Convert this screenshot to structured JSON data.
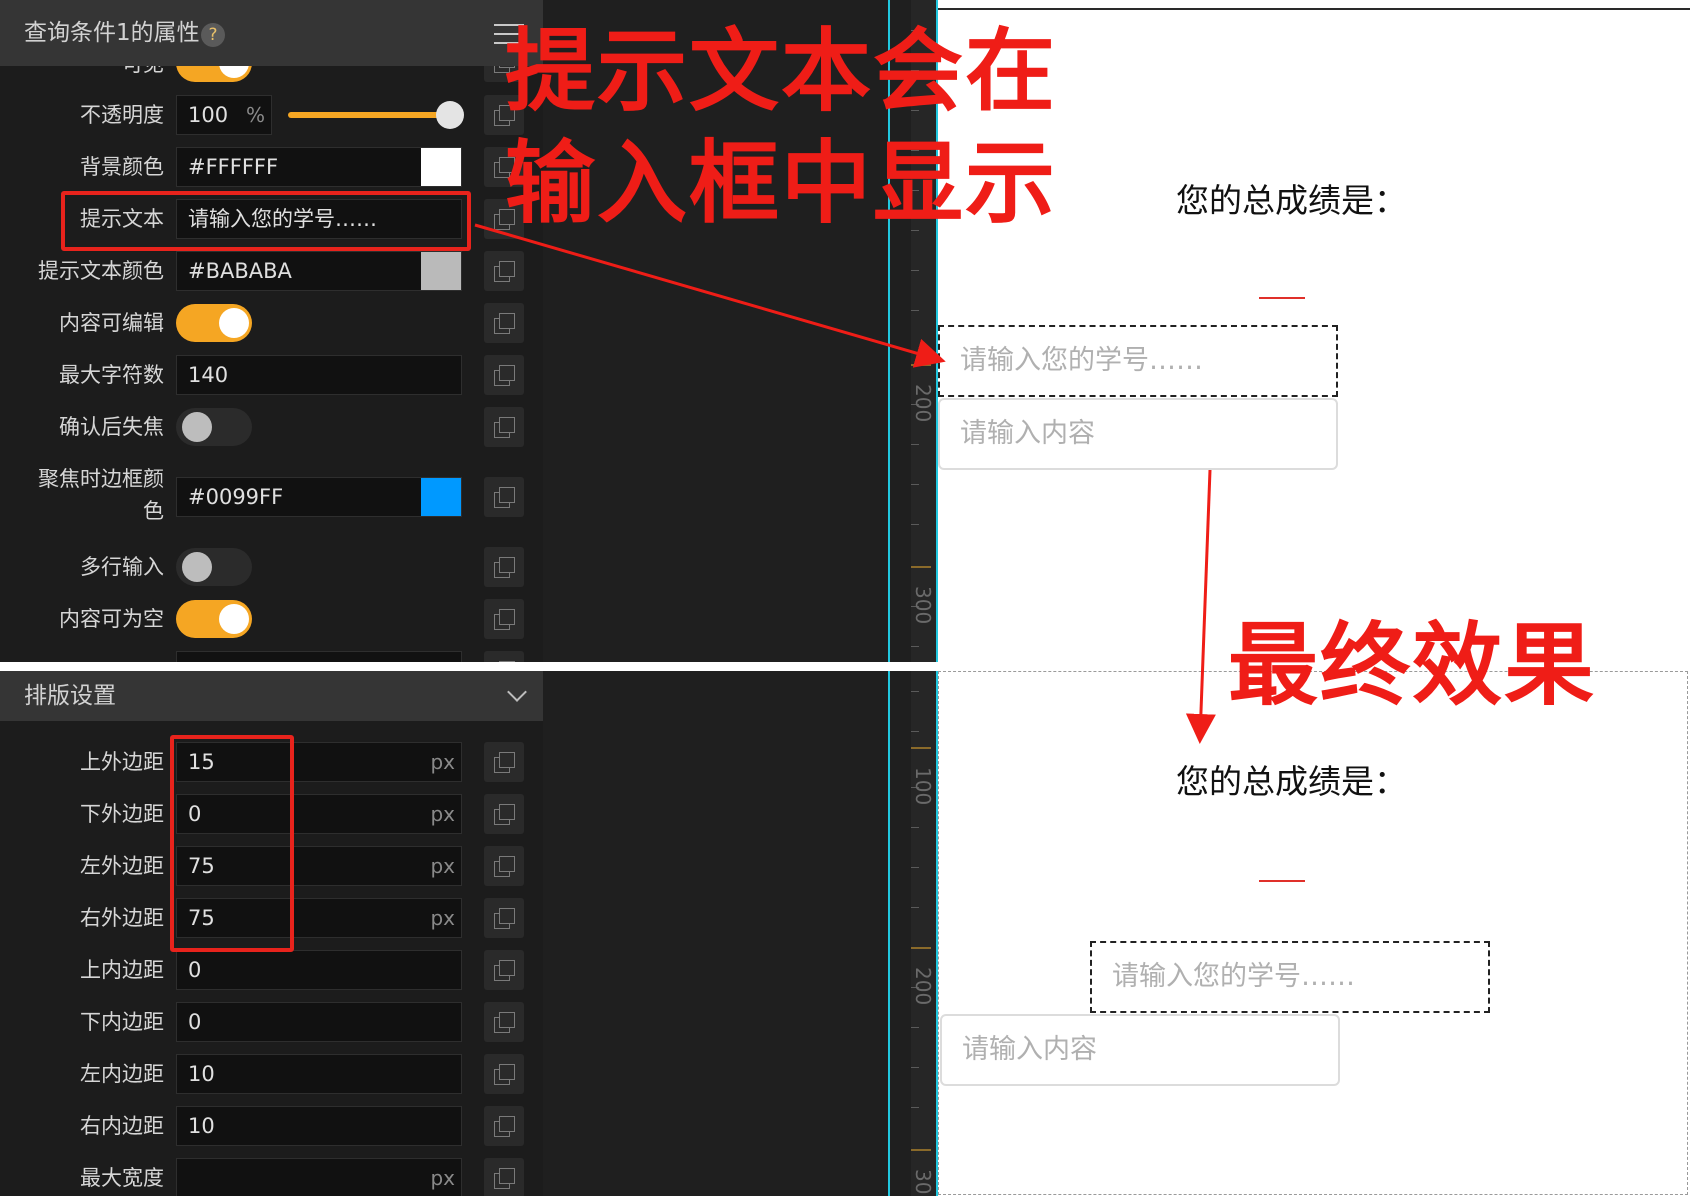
{
  "top_panel": {
    "title": "查询条件1的属性",
    "help": "?",
    "rows": {
      "visible": {
        "label": "可见",
        "on": true
      },
      "opacity": {
        "label": "不透明度",
        "value": "100",
        "unit": "%",
        "level": 1.0
      },
      "bg_color": {
        "label": "背景颜色",
        "value": "#FFFFFF",
        "swatch": "#FFFFFF"
      },
      "placeholder": {
        "label": "提示文本",
        "value": "请输入您的学号……"
      },
      "placeholder_color": {
        "label": "提示文本颜色",
        "value": "#BABABA",
        "swatch": "#BABABA"
      },
      "editable": {
        "label": "内容可编辑",
        "on": true
      },
      "max_chars": {
        "label": "最大字符数",
        "value": "140"
      },
      "blur_on_confirm": {
        "label": "确认后失焦",
        "on": false
      },
      "focus_border_color": {
        "label_line1": "聚焦时边框颜",
        "label_line2": "色",
        "value": "#0099FF",
        "swatch": "#0099FF"
      },
      "multiline": {
        "label": "多行输入",
        "on": false
      },
      "allow_empty": {
        "label": "内容可为空",
        "on": true
      }
    }
  },
  "layout_panel": {
    "title": "排版设置",
    "rows": [
      {
        "label": "上外边距",
        "value": "15",
        "unit": "px"
      },
      {
        "label": "下外边距",
        "value": "0",
        "unit": "px"
      },
      {
        "label": "左外边距",
        "value": "75",
        "unit": "px"
      },
      {
        "label": "右外边距",
        "value": "75",
        "unit": "px"
      },
      {
        "label": "上内边距",
        "value": "0",
        "unit": ""
      },
      {
        "label": "下内边距",
        "value": "0",
        "unit": ""
      },
      {
        "label": "左内边距",
        "value": "10",
        "unit": ""
      },
      {
        "label": "右内边距",
        "value": "10",
        "unit": ""
      },
      {
        "label": "最大宽度",
        "value": "",
        "unit": "px"
      }
    ]
  },
  "ruler": {
    "top_labels": [
      "200",
      "300"
    ],
    "bottom_labels": [
      "100",
      "200",
      "30"
    ]
  },
  "preview_top": {
    "heading": "您的总成绩是：",
    "input1_placeholder": "请输入您的学号……",
    "input2_placeholder": "请输入内容"
  },
  "preview_bottom": {
    "heading": "您的总成绩是：",
    "input1_placeholder": "请输入您的学号……",
    "input2_placeholder": "请输入内容"
  },
  "annotations": {
    "line1": "提示文本会在",
    "line2": "输入框中显示",
    "result": "最终效果",
    "color": "#EF1D17"
  }
}
